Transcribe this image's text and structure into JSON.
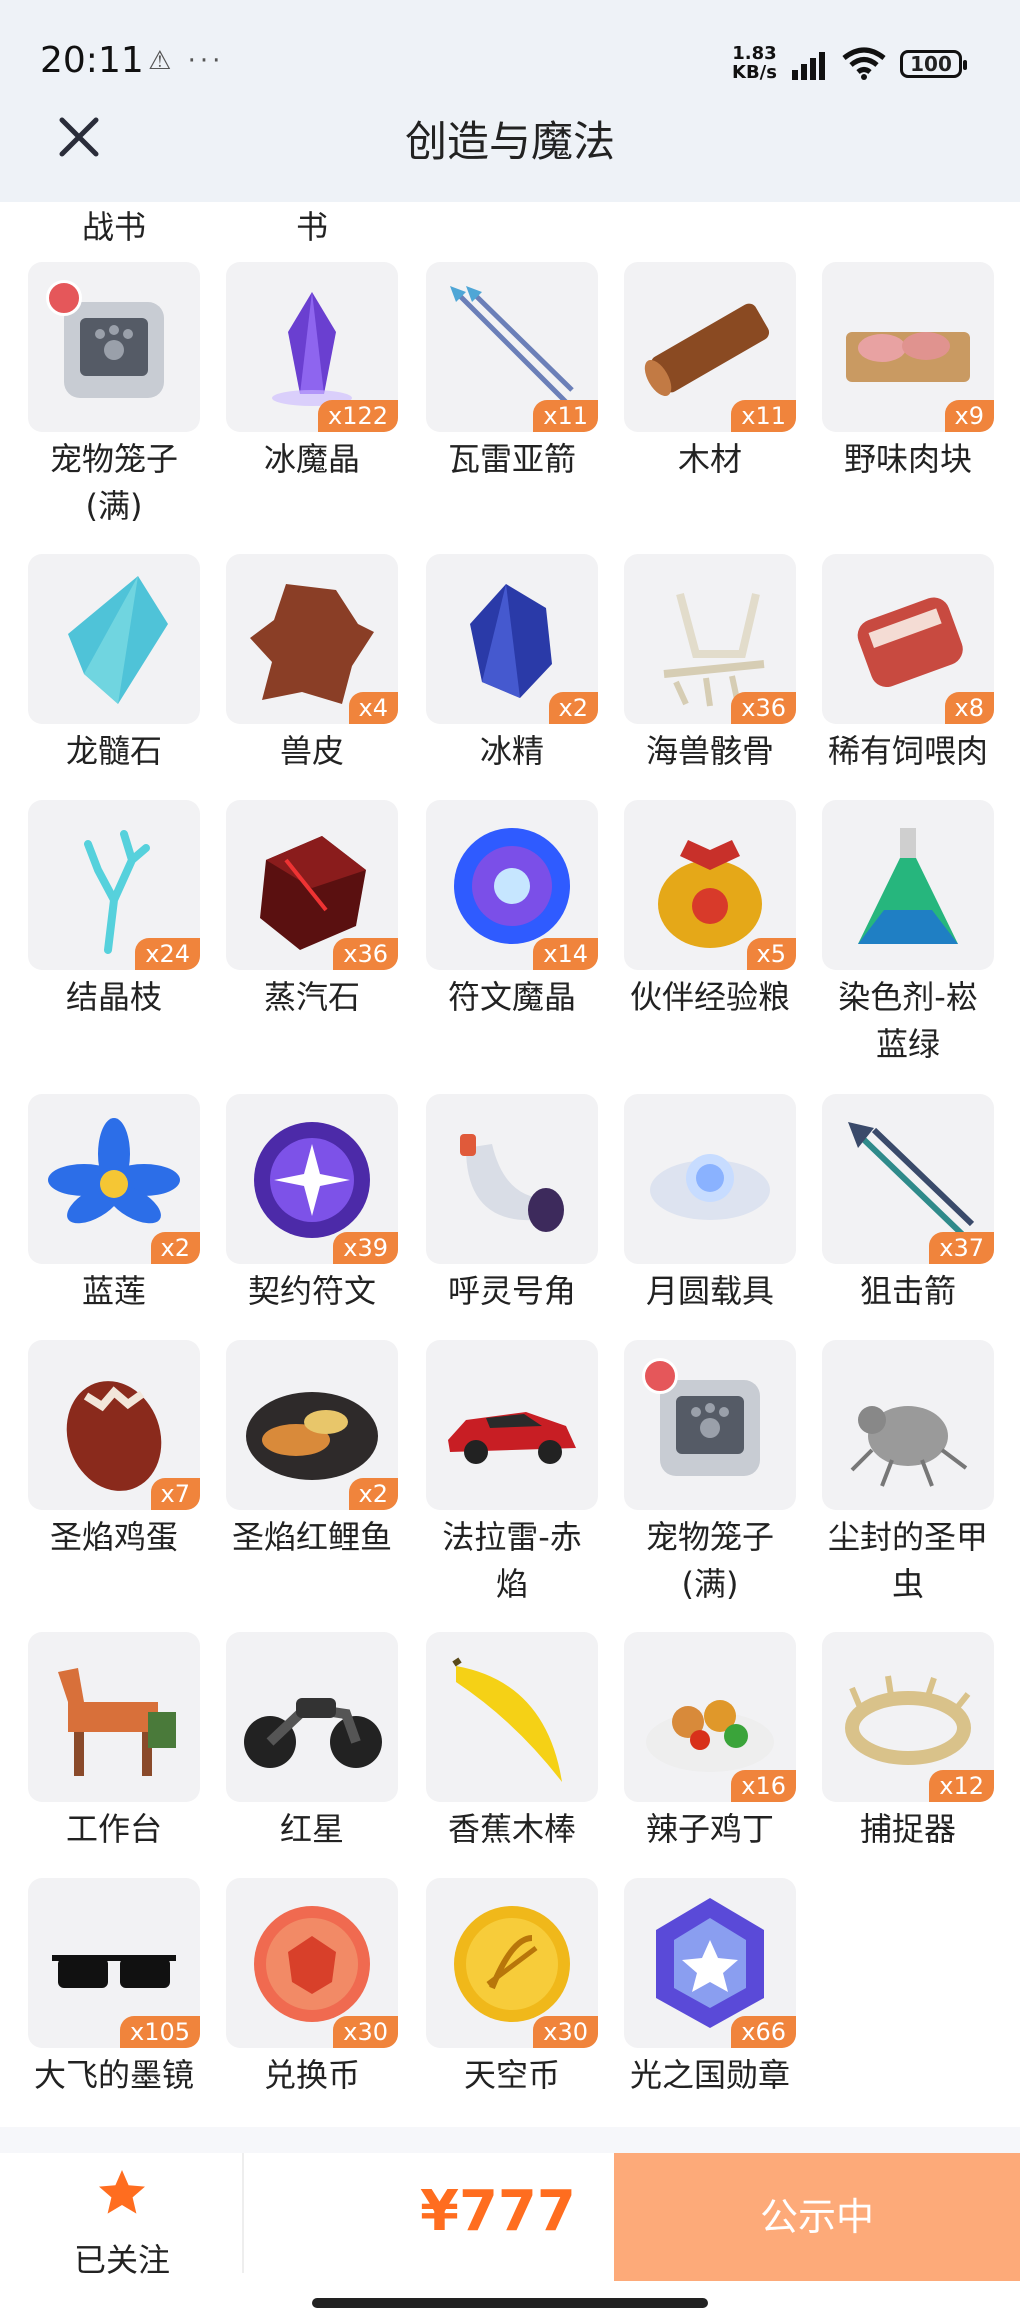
{
  "status_bar": {
    "time": "20:11",
    "left_icons": "⚠ ···",
    "speed_value": "1.83",
    "speed_unit": "KB/s",
    "battery": "100"
  },
  "header": {
    "title": "创造与魔法",
    "close_icon": "close-icon"
  },
  "partial_items": [
    "战书",
    "书"
  ],
  "items": [
    {
      "name": "宠物笼子\n(满)",
      "count": "",
      "icon": "pet-cage-icon",
      "locked": true
    },
    {
      "name": "冰魔晶",
      "count": "x122",
      "icon": "purple-crystal-icon"
    },
    {
      "name": "瓦雷亚箭",
      "count": "x11",
      "icon": "arrow-icon"
    },
    {
      "name": "木材",
      "count": "x11",
      "icon": "wood-log-icon"
    },
    {
      "name": "野味肉块",
      "count": "x9",
      "icon": "meat-tray-icon"
    },
    {
      "name": "龙髓石",
      "count": "",
      "icon": "dragon-stone-icon"
    },
    {
      "name": "兽皮",
      "count": "x4",
      "icon": "animal-hide-icon"
    },
    {
      "name": "冰精",
      "count": "x2",
      "icon": "blue-gem-icon"
    },
    {
      "name": "海兽骸骨",
      "count": "x36",
      "icon": "bone-icon"
    },
    {
      "name": "稀有饲喂肉",
      "count": "x8",
      "icon": "raw-meat-icon"
    },
    {
      "name": "结晶枝",
      "count": "x24",
      "icon": "crystal-branch-icon"
    },
    {
      "name": "蒸汽石",
      "count": "x36",
      "icon": "steam-stone-icon"
    },
    {
      "name": "符文魔晶",
      "count": "x14",
      "icon": "rune-orb-icon"
    },
    {
      "name": "伙伴经验粮",
      "count": "x5",
      "icon": "food-bag-icon"
    },
    {
      "name": "染色剂-崧\n蓝绿",
      "count": "",
      "icon": "dye-bottle-icon"
    },
    {
      "name": "蓝莲",
      "count": "x2",
      "icon": "blue-lotus-icon"
    },
    {
      "name": "契约符文",
      "count": "x39",
      "icon": "contract-rune-icon"
    },
    {
      "name": "呼灵号角",
      "count": "",
      "icon": "horn-icon"
    },
    {
      "name": "月圆载具",
      "count": "",
      "icon": "moon-cloud-icon"
    },
    {
      "name": "狙击箭",
      "count": "x37",
      "icon": "sniper-arrow-icon"
    },
    {
      "name": "圣焰鸡蛋",
      "count": "x7",
      "icon": "egg-icon"
    },
    {
      "name": "圣焰红鲤鱼",
      "count": "x2",
      "icon": "fish-plate-icon"
    },
    {
      "name": "法拉雷-赤\n焰",
      "count": "",
      "icon": "red-car-icon"
    },
    {
      "name": "宠物笼子\n(满)",
      "count": "",
      "icon": "pet-cage-icon",
      "locked": true
    },
    {
      "name": "尘封的圣甲\n虫",
      "count": "",
      "icon": "beetle-icon"
    },
    {
      "name": "工作台",
      "count": "",
      "icon": "workbench-horse-icon"
    },
    {
      "name": "红星",
      "count": "",
      "icon": "motorcycle-icon"
    },
    {
      "name": "香蕉木棒",
      "count": "",
      "icon": "banana-icon"
    },
    {
      "name": "辣子鸡丁",
      "count": "x16",
      "icon": "chicken-dish-icon"
    },
    {
      "name": "捕捉器",
      "count": "x12",
      "icon": "catcher-ring-icon"
    },
    {
      "name": "大飞的墨镜",
      "count": "x105",
      "icon": "sunglasses-icon"
    },
    {
      "name": "兑换币",
      "count": "x30",
      "icon": "exchange-coin-icon"
    },
    {
      "name": "天空币",
      "count": "x30",
      "icon": "sky-coin-icon"
    },
    {
      "name": "光之国勋章",
      "count": "x66",
      "icon": "medal-icon"
    }
  ],
  "bottom": {
    "follow_label": "已关注",
    "price": "¥777",
    "status_button": "公示中"
  }
}
